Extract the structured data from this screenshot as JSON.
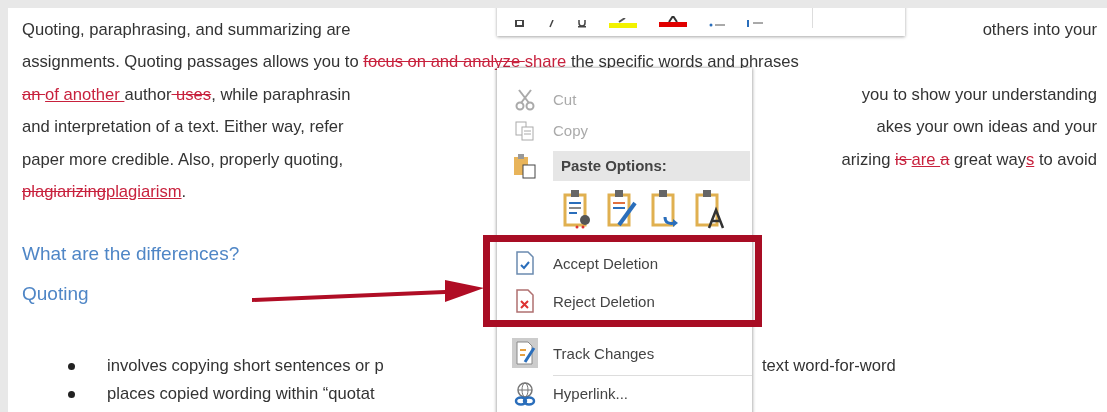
{
  "document": {
    "lines": [
      {
        "left": [
          {
            "kind": "normal",
            "text": "Quoting, paraphrasing, and summarizing are"
          }
        ],
        "right": [
          {
            "kind": "normal",
            "text": "others into your"
          }
        ]
      },
      {
        "left": [
          {
            "kind": "normal",
            "text": "assignments. Quoting passages allows you to "
          },
          {
            "kind": "deleted",
            "text": "focus on and analyze "
          },
          {
            "kind": "inserted",
            "text": "share "
          },
          {
            "kind": "normal",
            "text": "the specific words and phrases"
          }
        ]
      },
      {
        "left": [
          {
            "kind": "deleted",
            "text": "an "
          },
          {
            "kind": "inserted",
            "text": "of another "
          },
          {
            "kind": "normal",
            "text": "author"
          },
          {
            "kind": "deleted",
            "text": " uses"
          },
          {
            "kind": "normal",
            "text": ", while paraphrasin"
          }
        ],
        "right": [
          {
            "kind": "normal",
            "text": "you to show your understanding"
          }
        ]
      },
      {
        "left": [
          {
            "kind": "normal",
            "text": "and interpretation of a text. Either way, refer"
          }
        ],
        "right": [
          {
            "kind": "normal",
            "text": "akes your own ideas and your"
          }
        ]
      },
      {
        "left": [
          {
            "kind": "normal",
            "text": "paper more credible. Also, properly quoting,"
          }
        ],
        "right": [
          {
            "kind": "normal",
            "text": "arizing "
          },
          {
            "kind": "deleted",
            "text": "is "
          },
          {
            "kind": "inserted",
            "text": "are "
          },
          {
            "kind": "deleted",
            "text": "a"
          },
          {
            "kind": "normal",
            "text": " great way"
          },
          {
            "kind": "inserted",
            "text": "s"
          },
          {
            "kind": "normal",
            "text": " to avoid"
          }
        ]
      },
      {
        "left": [
          {
            "kind": "deleted",
            "text": "plagiarizing"
          },
          {
            "kind": "inserted",
            "text": "plagiarism"
          },
          {
            "kind": "normal",
            "text": "."
          }
        ]
      }
    ],
    "headings": [
      "What are the differences?",
      "Quoting"
    ],
    "bullets": [
      {
        "left": "involves copying short sentences or p",
        "right": "text word-for-word"
      },
      {
        "left": "places copied wording within “quotat"
      }
    ]
  },
  "context_menu": {
    "items": [
      {
        "kind": "command",
        "label": "Cut",
        "disabled": true,
        "boxed": false
      },
      {
        "kind": "command",
        "label": "Copy",
        "disabled": true,
        "boxed": false
      },
      {
        "kind": "header",
        "label": "Paste Options:"
      },
      {
        "kind": "paste_row"
      },
      {
        "kind": "command",
        "label": "Accept Deletion",
        "disabled": false,
        "boxed": true
      },
      {
        "kind": "command",
        "label": "Reject Deletion",
        "disabled": false,
        "boxed": true
      },
      {
        "kind": "command",
        "label": "Track Changes",
        "disabled": false,
        "boxed": false
      },
      {
        "kind": "separator"
      },
      {
        "kind": "command",
        "label": "Hyperlink...",
        "disabled": false,
        "boxed": false
      }
    ]
  }
}
